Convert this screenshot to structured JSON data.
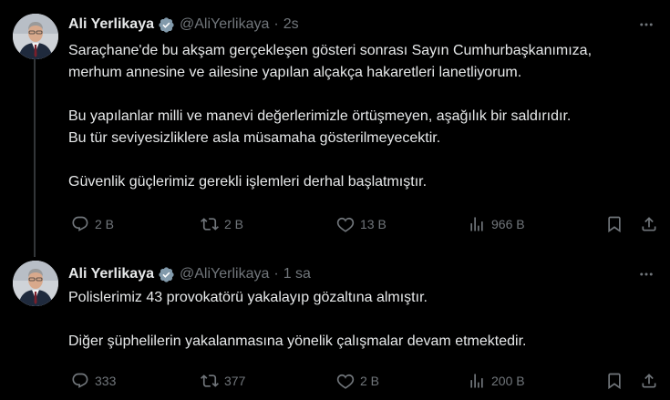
{
  "colors": {
    "background": "#000000",
    "text_primary": "#e7e9ea",
    "text_secondary": "#71767b",
    "verified_badge": "#829aab",
    "thread_line": "#333639"
  },
  "tweets": [
    {
      "author_name": "Ali Yerlikaya",
      "handle": "@AliYerlikaya",
      "separator": "·",
      "time": "2s",
      "verified_icon": "verified-badge-icon",
      "text_lines": [
        "Saraçhane'de bu akşam gerçekleşen gösteri sonrası Sayın Cumhurbaşkanımıza,",
        "merhum annesine ve ailesine yapılan alçakça hakaretleri lanetliyorum.",
        "Bu yapılanlar milli ve manevi değerlerimizle örtüşmeyen, aşağılık bir saldırıdır.",
        "Bu tür seviyesizliklere asla müsamaha gösterilmeyecektir.",
        "Güvenlik güçlerimiz gerekli işlemleri derhal başlatmıştır."
      ],
      "actions": {
        "replies": "2 B",
        "reposts": "2 B",
        "likes": "13 B",
        "views": "966 B"
      }
    },
    {
      "author_name": "Ali Yerlikaya",
      "handle": "@AliYerlikaya",
      "separator": "·",
      "time": "1 sa",
      "verified_icon": "verified-badge-icon",
      "text_lines": [
        "Polislerimiz 43 provokatörü yakalayıp gözaltına almıştır.",
        "Diğer şüphelilerin yakalanmasına yönelik çalışmalar devam etmektedir."
      ],
      "actions": {
        "replies": "333",
        "reposts": "377",
        "likes": "2 B",
        "views": "200 B"
      }
    }
  ]
}
